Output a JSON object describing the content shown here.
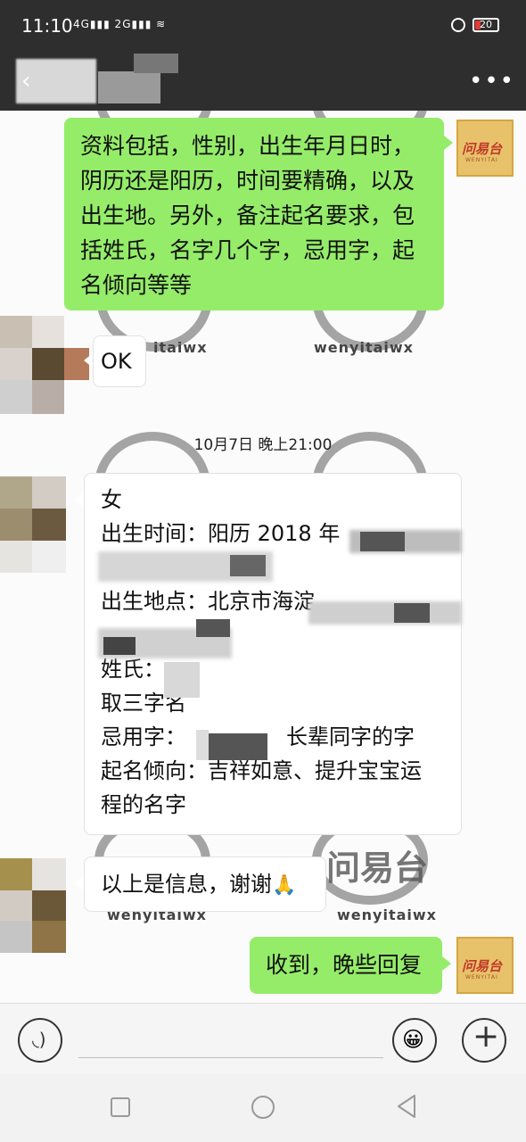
{
  "status_bar": {
    "time": "11:10",
    "signal_text": "4G▮▮▮ 2G▮▮▮ ≋",
    "battery": "20",
    "battery_color": "#e53935"
  },
  "title_bar": {
    "back_icon": "chevron-left-icon",
    "more_label": "•••"
  },
  "watermark": {
    "handle": "wenyitaiwx",
    "brand_chars": "问易台",
    "handle_partial_top": "itaiwx",
    "handle_partial_bottom": "wenyitaiwx"
  },
  "avatar": {
    "brand_text": "问易台",
    "brand_sub": "WENYITAI"
  },
  "messages": [
    {
      "side": "right",
      "text": "资料包括，性别，出生年月日时，阴历还是阳历，时间要精确，以及出生地。另外，备注起名要求，包括姓氏，名字几个字，忌用字，起名倾向等等"
    },
    {
      "side": "left",
      "text": "OK"
    },
    {
      "type": "time",
      "text": "10月7日 晚上21:00"
    },
    {
      "side": "left",
      "lines": [
        "女",
        "出生时间：阳历 2018 年",
        "上午",
        "出生地点：北京市海淀",
        "",
        "姓氏：",
        "取三字名",
        "忌用字：",
        "长辈同字的字",
        "起名倾向：吉祥如意、提升宝宝运",
        "程的名字"
      ]
    },
    {
      "side": "left",
      "text": "以上是信息，谢谢",
      "emoji": "🙏"
    },
    {
      "side": "right",
      "text": "收到，晚些回复"
    }
  ],
  "input_bar": {
    "voice_icon": "voice-icon",
    "emoji_icon": "emoji-icon",
    "plus_icon": "plus-icon",
    "emoji_glyph": "😀",
    "plus_glyph": "+"
  },
  "colors": {
    "my_bubble": "#95ec69",
    "their_bubble": "#ffffff",
    "header": "#2e2e2e"
  }
}
